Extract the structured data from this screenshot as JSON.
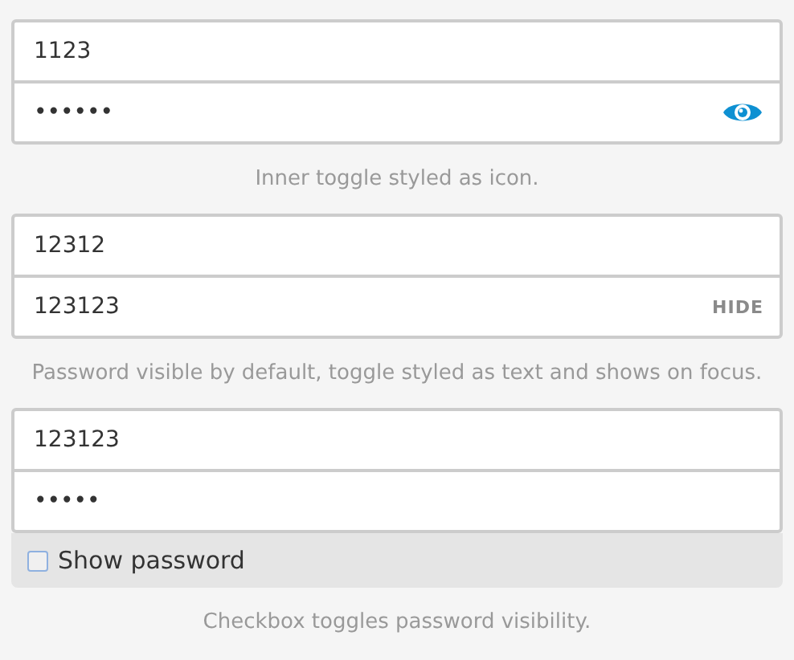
{
  "forms": [
    {
      "fields": [
        {
          "kind": "text",
          "value": "1123"
        },
        {
          "kind": "password",
          "value": "••••••"
        }
      ],
      "toggle": {
        "kind": "icon"
      },
      "caption": "Inner toggle styled as icon."
    },
    {
      "fields": [
        {
          "kind": "text",
          "value": "12312"
        },
        {
          "kind": "password",
          "value": "123123"
        }
      ],
      "toggle": {
        "kind": "text",
        "label": "HIDE"
      },
      "caption": "Password visible by default, toggle styled as text and shows on focus."
    },
    {
      "fields": [
        {
          "kind": "text",
          "value": "123123"
        },
        {
          "kind": "password",
          "value": "•••••"
        }
      ],
      "toggle": {
        "kind": "checkbox",
        "label": "Show password",
        "checked": false
      },
      "caption": "Checkbox toggles password visibility."
    }
  ]
}
